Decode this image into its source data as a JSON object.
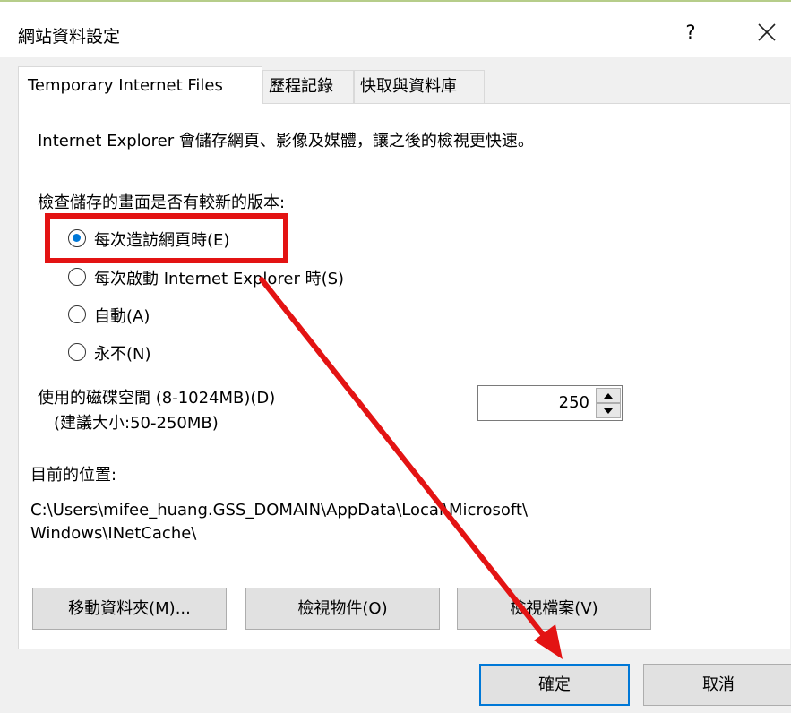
{
  "window": {
    "title": "網站資料設定",
    "help_label": "?"
  },
  "tabs": [
    {
      "label": "Temporary Internet Files",
      "active": true
    },
    {
      "label": "歷程記錄",
      "active": false
    },
    {
      "label": "快取與資料庫",
      "active": false
    }
  ],
  "panel": {
    "description": "Internet Explorer 會儲存網頁、影像及媒體，讓之後的檢視更快速。",
    "check_heading": "檢查儲存的畫面是否有較新的版本:",
    "radio_options": [
      {
        "label": "每次造訪網頁時(E)",
        "selected": true
      },
      {
        "label": "每次啟動 Internet Explorer 時(S)",
        "selected": false
      },
      {
        "label": "自動(A)",
        "selected": false
      },
      {
        "label": "永不(N)",
        "selected": false
      }
    ],
    "disk_space_label": "使用的磁碟空間 (8-1024MB)(D)",
    "disk_space_hint": "(建議大小:50-250MB)",
    "disk_space_value": "250",
    "location_label": "目前的位置:",
    "location_path_line1": "C:\\Users\\mifee_huang.GSS_DOMAIN\\AppData\\Local\\Microsoft\\",
    "location_path_line2": "Windows\\INetCache\\",
    "buttons": {
      "move_folder": "移動資料夾(M)...",
      "view_objects": "檢視物件(O)",
      "view_files": "檢視檔案(V)"
    }
  },
  "footer": {
    "ok_label": "確定",
    "cancel_label": "取消"
  },
  "colors": {
    "annotation": "#e31313",
    "accent": "#0078d7"
  }
}
